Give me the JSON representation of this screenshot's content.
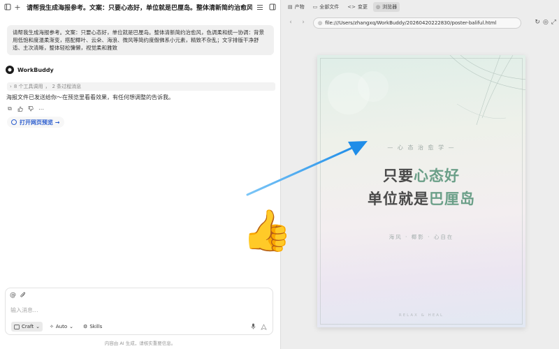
{
  "conversation": {
    "title": "请帮我生成海报参考。文案：只要心态好，单位就是巴厘岛。整体清新简约治愈风，色调柔和统..."
  },
  "user_message": {
    "text": "请帮我生成海报参考。文案：只要心态好，单位就是巴厘岛。整体清新简约治愈风，色调柔和统一协调：背景用低饱和度温柔渐变，搭配椰叶、云朵、海浪、微风等简约度假佛系小元素，精致不杂乱；文字排版干净舒适、主次清晰，整体轻松慵懒，视觉柔和雅致"
  },
  "assistant": {
    "name": "WorkBuddy",
    "tool_summary": {
      "tool_count": "8 个工具调用",
      "separator": "，",
      "process_count": "2 条过程消息"
    },
    "message": "海报文件已发送给你～在预览里看看效果，有任何想调整的告诉我。",
    "open_preview_label": "打开网页预览 →"
  },
  "composer": {
    "placeholder": "输入消息...",
    "craft_label": "Craft",
    "auto_label": "Auto",
    "skills_label": "Skills"
  },
  "disclaimer": "内容由 AI 生成，请核实重要信息。",
  "browser": {
    "tabs": [
      {
        "label": "产物",
        "icon": "document-icon"
      },
      {
        "label": "全部文件",
        "icon": "files-icon"
      },
      {
        "label": "变更",
        "icon": "code-icon"
      },
      {
        "label": "浏览器",
        "icon": "globe-icon",
        "active": true
      }
    ],
    "url": "file:///Users/zhangxq/WorkBuddy/20260420222830/poster-baliful.html"
  },
  "poster": {
    "kicker": "— 心 态 治 愈 学 —",
    "line1_prefix": "只要",
    "line1_highlight": "心态好",
    "line2_prefix": "单位就是",
    "line2_highlight": "巴厘岛",
    "subline": "海风 · 椰影 · 心自在",
    "footer": "RELAX & HEAL"
  },
  "colors": {
    "accent_blue": "#2b5dce",
    "poster_highlight": "#6b9f88",
    "arrow": "#2e9bf0"
  }
}
